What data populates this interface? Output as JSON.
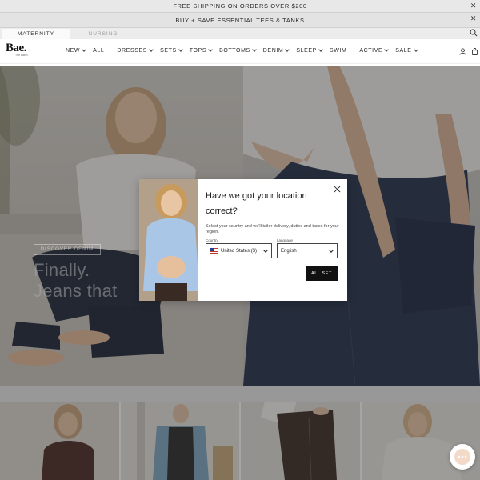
{
  "announcement": {
    "primary": "FREE SHIPPING ON ORDERS OVER $200",
    "secondary": "BUY + SAVE ESSENTIAL TEES & TANKS"
  },
  "segments": [
    {
      "label": "MATERNITY",
      "active": true
    },
    {
      "label": "NURSING",
      "active": false
    }
  ],
  "brand": {
    "logo": "Bae.",
    "tagline": "The Label"
  },
  "nav": {
    "items": [
      {
        "label": "NEW",
        "has_dropdown": true
      },
      {
        "label": "ALL",
        "has_dropdown": false
      },
      {
        "label": "DRESSES",
        "has_dropdown": true
      },
      {
        "label": "SETS",
        "has_dropdown": true
      },
      {
        "label": "TOPS",
        "has_dropdown": true
      },
      {
        "label": "BOTTOMS",
        "has_dropdown": true
      },
      {
        "label": "DENIM",
        "has_dropdown": true
      },
      {
        "label": "SLEEP",
        "has_dropdown": true
      },
      {
        "label": "SWIM",
        "has_dropdown": false
      },
      {
        "label": "ACTIVE",
        "has_dropdown": true
      },
      {
        "label": "SALE",
        "has_dropdown": true
      }
    ],
    "icons": [
      "account-icon",
      "cart-icon"
    ]
  },
  "hero": {
    "headline_line1": "Finally.",
    "headline_line2": "Jeans that",
    "cta": "DISCOVER DENIM"
  },
  "modal": {
    "title": "Have we got your location correct?",
    "description": "Select your country and we'll tailor delivery, duties and taxes for your region.",
    "country_label": "Country",
    "country_value": "United States ($)",
    "language_label": "Language",
    "language_value": "English",
    "submit": "ALL SET"
  },
  "colors": {
    "overlay": "#282828",
    "button": "#111111",
    "announcement_bg": "#e8e8e8"
  }
}
